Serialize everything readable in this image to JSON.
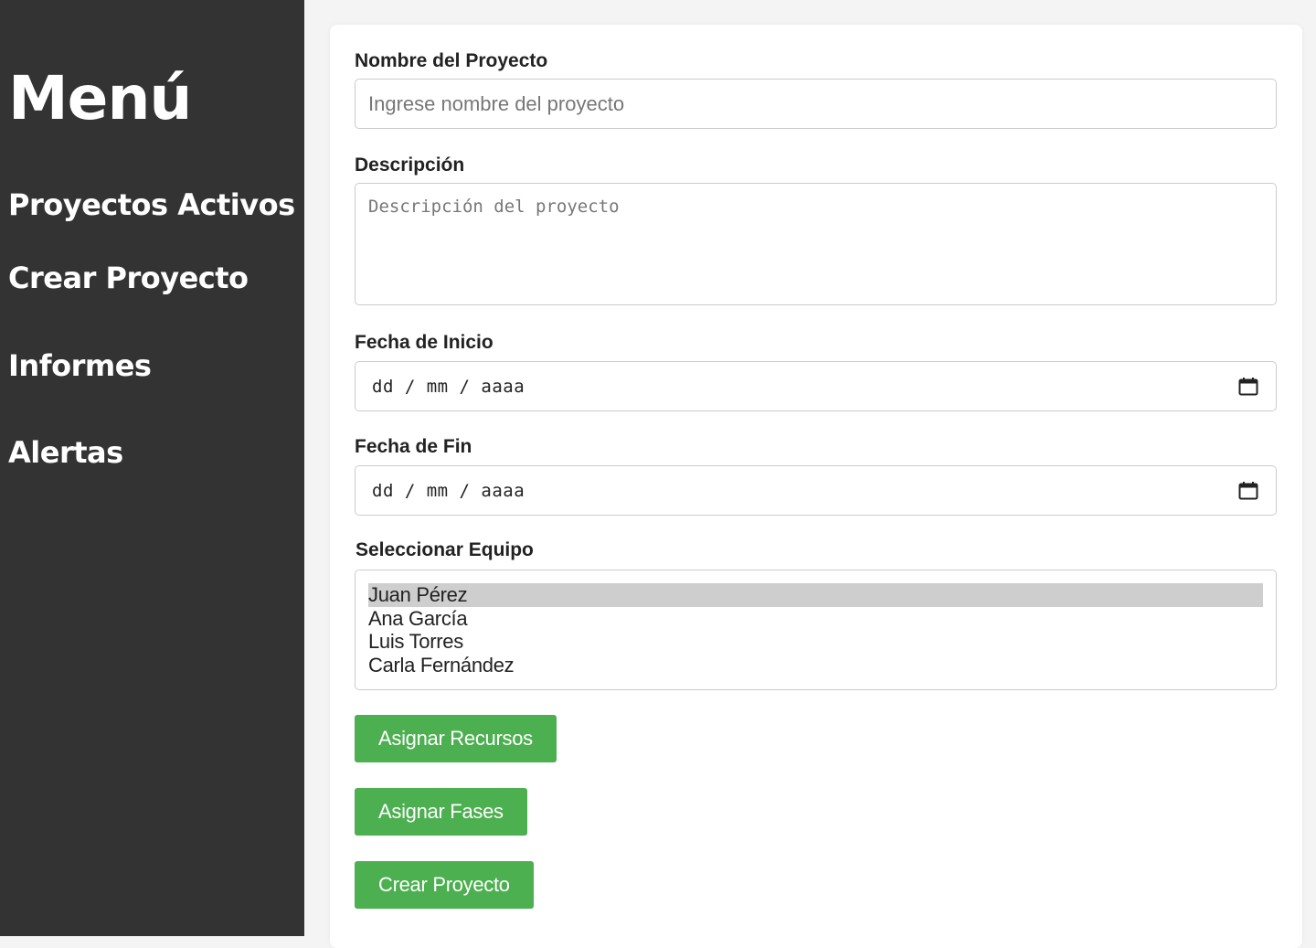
{
  "sidebar": {
    "title": "Menú",
    "items": [
      {
        "label": "Proyectos Activos"
      },
      {
        "label": "Crear Proyecto"
      },
      {
        "label": "Informes"
      },
      {
        "label": "Alertas"
      }
    ]
  },
  "form": {
    "name_label": "Nombre del Proyecto",
    "name_placeholder": "Ingrese nombre del proyecto",
    "name_value": "",
    "description_label": "Descripción",
    "description_placeholder": "Descripción del proyecto",
    "description_value": "",
    "start_label": "Fecha de Inicio",
    "start_value": "dd / mm / aaaa",
    "end_label": "Fecha de Fin",
    "end_value": "dd / mm / aaaa",
    "team_label": "Seleccionar Equipo",
    "team_options": [
      "Juan Pérez",
      "Ana García",
      "Luis Torres",
      "Carla Fernández"
    ],
    "team_selected": "Juan Pérez"
  },
  "buttons": {
    "assign_resources": "Asignar Recursos",
    "assign_phases": "Asignar Fases",
    "create_project": "Crear Proyecto"
  },
  "colors": {
    "sidebar_bg": "#333333",
    "button_bg": "#4caf50",
    "selected_option_bg": "#cecece"
  },
  "icons": {
    "date_picker": "calendar-icon"
  }
}
